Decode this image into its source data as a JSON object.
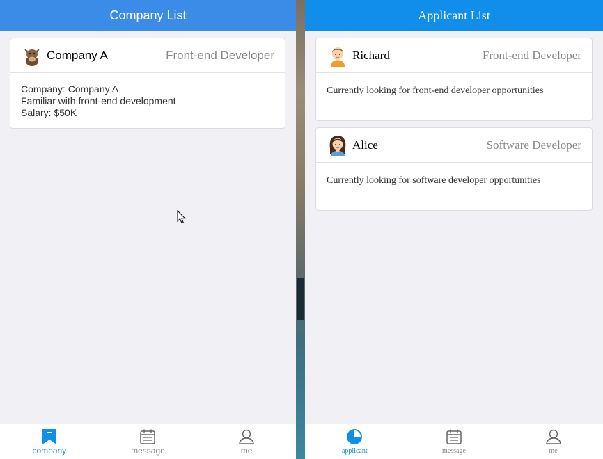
{
  "left_window": {
    "title": "Company List",
    "card": {
      "name": "Company A",
      "position": "Front-end Developer",
      "lines": [
        "Company: Company A",
        "Familiar with front-end development",
        "Salary: $50K"
      ],
      "avatar_icon": "cow-avatar-icon"
    },
    "tabs": [
      {
        "label": "company",
        "icon": "bookmark-icon",
        "active": true
      },
      {
        "label": "message",
        "icon": "calendar-icon",
        "active": false
      },
      {
        "label": "me",
        "icon": "user-icon",
        "active": false
      }
    ]
  },
  "right_window": {
    "title": "Applicant List",
    "cards": [
      {
        "name": "Richard",
        "position": "Front-end Developer",
        "description": "Currently looking for front-end developer opportunities",
        "avatar_icon": "boy-avatar-icon"
      },
      {
        "name": "Alice",
        "position": "Software Developer",
        "description": "Currently looking for software developer opportunities",
        "avatar_icon": "girl-avatar-icon"
      }
    ],
    "tabs": [
      {
        "label": "applicant",
        "icon": "pie-chart-icon",
        "active": true
      },
      {
        "label": "message",
        "icon": "calendar-icon",
        "active": false
      },
      {
        "label": "me",
        "icon": "user-icon",
        "active": false
      }
    ]
  },
  "colors": {
    "left_header": "#3b8ce6",
    "right_header": "#108ee9",
    "active_tab": "#108ee9",
    "inactive_tab": "#888888",
    "background": "#f1f1f5"
  }
}
